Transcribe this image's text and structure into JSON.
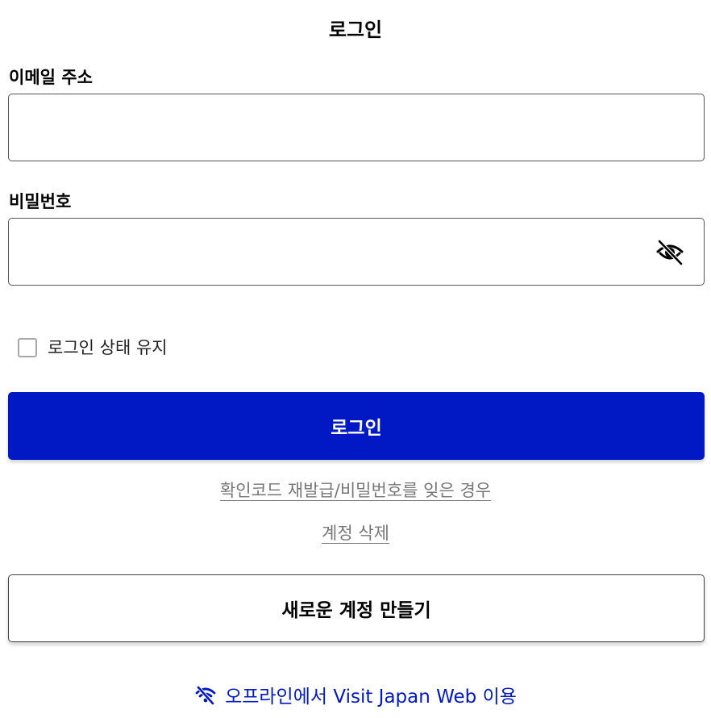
{
  "page": {
    "title": "로그인"
  },
  "form": {
    "email_label": "이메일 주소",
    "email_value": "",
    "password_label": "비밀번호",
    "password_value": "",
    "password_toggle_icon": "eye-slash-icon",
    "remember_label": "로그인 상태 유지",
    "remember_checked": false
  },
  "actions": {
    "login_label": "로그인",
    "reissue_link": "확인코드 재발급/비밀번호를 잊은 경우",
    "delete_link": "계정 삭제",
    "create_account_label": "새로운 계정 만들기",
    "offline_label": "오프라인에서 Visit Japan Web 이용",
    "offline_icon": "wifi-off-icon"
  },
  "colors": {
    "primary": "#0019c4",
    "link_gray": "#777777",
    "border": "#555555"
  }
}
